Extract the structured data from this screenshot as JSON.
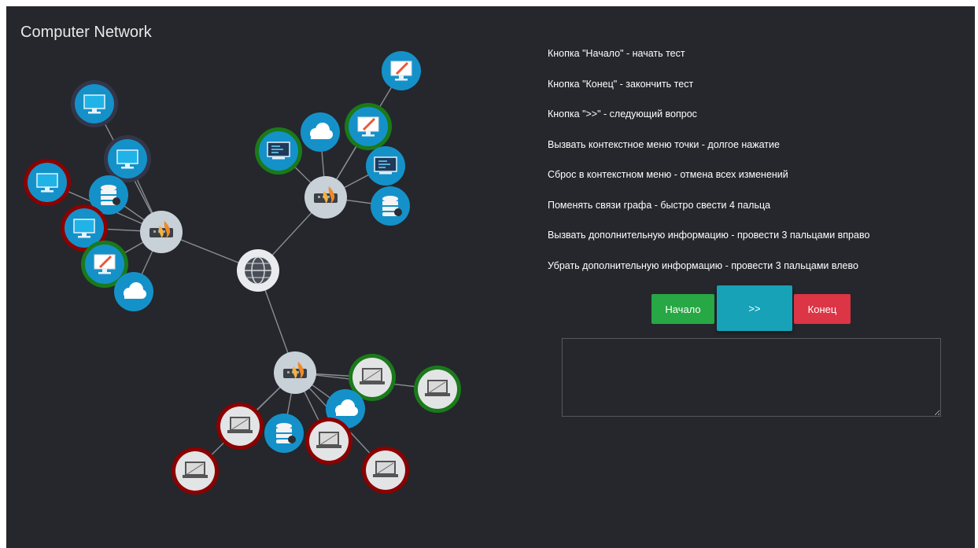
{
  "title": "Computer Network",
  "instructions": [
    "Кнопка \"Начало\" - начать тест",
    "Кнопка \"Конец\" - закончить тест",
    "Кнопка \">>\" - следующий вопрос",
    "Вызвать контекстное меню точки - долгое нажатие",
    "Сброс в контекстном меню - отмена всех изменений",
    "Поменять связи графа - быстро свести 4 пальца",
    "Вызвать дополнительную информацию - провести 3 пальцами вправо",
    "Убрать дополнительную информацию - провести 3 пальцами влево"
  ],
  "buttons": {
    "start": "Начало",
    "next": ">>",
    "end": "Конец"
  },
  "answer": {
    "value": "",
    "placeholder": ""
  },
  "colors": {
    "background": "#25272c",
    "status_red": "#8b0000",
    "status_green": "#1a7a1a",
    "status_dark": "#33364a",
    "node_blue": "#1591c9",
    "router_gray": "#c8d0d8",
    "edge": "#8a8d93"
  },
  "graph": {
    "nodes": [
      {
        "id": "globe",
        "type": "internet",
        "ring": "none"
      },
      {
        "id": "router-left",
        "type": "router",
        "ring": "none"
      },
      {
        "id": "router-right",
        "type": "router",
        "ring": "none"
      },
      {
        "id": "router-bottom",
        "type": "router",
        "ring": "none"
      },
      {
        "id": "pc-l1",
        "type": "monitor",
        "ring": "dark"
      },
      {
        "id": "pc-l2",
        "type": "monitor",
        "ring": "dark"
      },
      {
        "id": "pc-l3",
        "type": "monitor",
        "ring": "red"
      },
      {
        "id": "db-l",
        "type": "database",
        "ring": "none"
      },
      {
        "id": "pc-l4",
        "type": "monitor",
        "ring": "red"
      },
      {
        "id": "paint-l",
        "type": "design",
        "ring": "green"
      },
      {
        "id": "cloud-l",
        "type": "cloud",
        "ring": "none"
      },
      {
        "id": "paint-r1",
        "type": "design",
        "ring": "none"
      },
      {
        "id": "paint-r2",
        "type": "design",
        "ring": "green"
      },
      {
        "id": "cloud-r",
        "type": "cloud",
        "ring": "none"
      },
      {
        "id": "code-r1",
        "type": "code",
        "ring": "green"
      },
      {
        "id": "code-r2",
        "type": "code",
        "ring": "none"
      },
      {
        "id": "db-r",
        "type": "database",
        "ring": "none"
      },
      {
        "id": "lap-b1",
        "type": "laptop",
        "ring": "green"
      },
      {
        "id": "lap-b2",
        "type": "laptop",
        "ring": "green"
      },
      {
        "id": "cloud-b",
        "type": "cloud",
        "ring": "none"
      },
      {
        "id": "lap-b3",
        "type": "laptop",
        "ring": "red"
      },
      {
        "id": "db-b",
        "type": "database",
        "ring": "none"
      },
      {
        "id": "lap-b4",
        "type": "laptop",
        "ring": "red"
      },
      {
        "id": "lap-b5",
        "type": "laptop",
        "ring": "red"
      },
      {
        "id": "lap-b6",
        "type": "laptop",
        "ring": "red"
      }
    ],
    "edges": [
      [
        "globe",
        "router-left"
      ],
      [
        "globe",
        "router-right"
      ],
      [
        "globe",
        "router-bottom"
      ],
      [
        "router-left",
        "pc-l1"
      ],
      [
        "router-left",
        "pc-l2"
      ],
      [
        "router-left",
        "pc-l3"
      ],
      [
        "router-left",
        "db-l"
      ],
      [
        "router-left",
        "pc-l4"
      ],
      [
        "router-left",
        "paint-l"
      ],
      [
        "router-left",
        "cloud-l"
      ],
      [
        "router-right",
        "paint-r1"
      ],
      [
        "router-right",
        "paint-r2"
      ],
      [
        "router-right",
        "cloud-r"
      ],
      [
        "router-right",
        "code-r1"
      ],
      [
        "router-right",
        "code-r2"
      ],
      [
        "router-right",
        "db-r"
      ],
      [
        "router-bottom",
        "lap-b1"
      ],
      [
        "router-bottom",
        "lap-b2"
      ],
      [
        "router-bottom",
        "cloud-b"
      ],
      [
        "router-bottom",
        "lap-b3"
      ],
      [
        "router-bottom",
        "db-b"
      ],
      [
        "router-bottom",
        "lap-b4"
      ],
      [
        "router-bottom",
        "lap-b5"
      ],
      [
        "router-bottom",
        "lap-b6"
      ]
    ]
  }
}
